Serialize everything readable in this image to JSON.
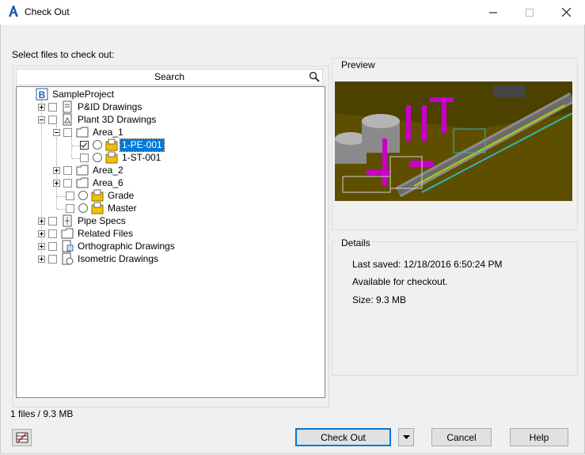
{
  "window": {
    "title": "Check Out",
    "icon": "autocad-icon"
  },
  "instructions": "Select files to check out:",
  "search": {
    "placeholder": "Search",
    "icon": "search-icon"
  },
  "tree": {
    "root": "SampleProject",
    "pid": "P&ID Drawings",
    "plant3d": "Plant 3D Drawings",
    "area1": "Area_1",
    "file1": "1-PE-001",
    "file2": "1-ST-001",
    "area2": "Area_2",
    "area6": "Area_6",
    "grade": "Grade",
    "master": "Master",
    "pipespecs": "Pipe Specs",
    "related": "Related Files",
    "ortho": "Orthographic Drawings",
    "iso": "Isometric Drawings"
  },
  "preview": {
    "label": "Preview"
  },
  "details": {
    "label": "Details",
    "last_saved": "Last saved: 12/18/2016 6:50:24 PM",
    "availability": "Available for checkout.",
    "size": "Size: 9.3 MB"
  },
  "status": {
    "file_count": "1 files / 9.3 MB"
  },
  "buttons": {
    "checkout": "Check Out",
    "cancel": "Cancel",
    "help": "Help"
  },
  "colors": {
    "selection": "#0078d7",
    "preview_bg": "#5e4f00",
    "accent": "#0078d7"
  }
}
